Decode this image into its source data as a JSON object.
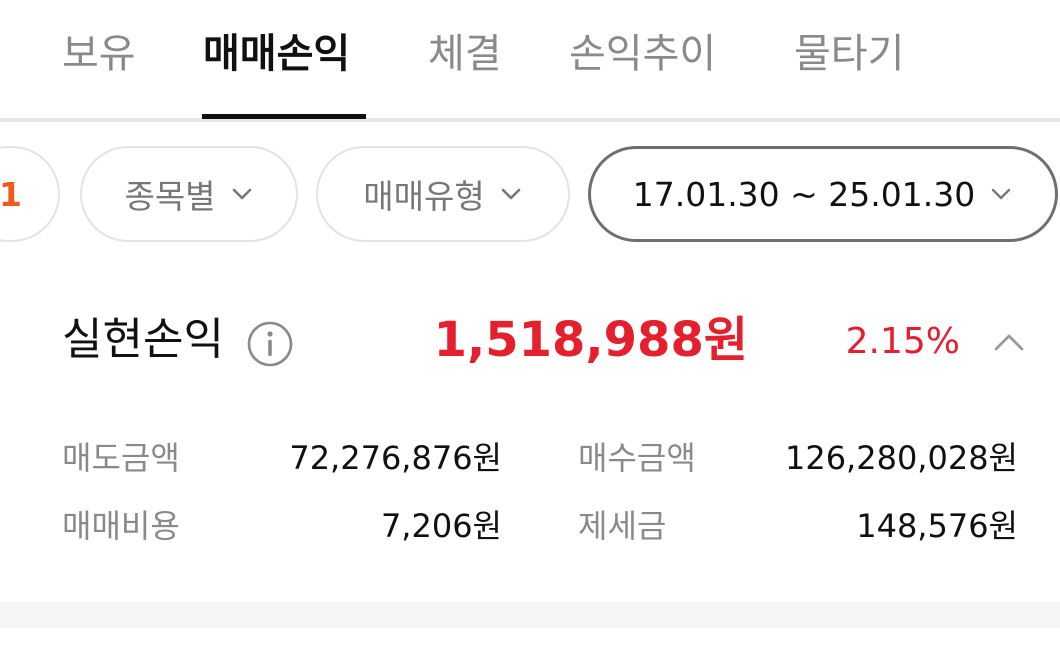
{
  "tabs": [
    {
      "label": "보유",
      "active": false
    },
    {
      "label": "매매손익",
      "active": true
    },
    {
      "label": "체결",
      "active": false
    },
    {
      "label": "손익추이",
      "active": false
    },
    {
      "label": "물타기",
      "active": false
    }
  ],
  "filters": {
    "partial_chip": "1",
    "by_item": "종목별",
    "trade_type": "매매유형",
    "date_range": "17.01.30 ~ 25.01.30"
  },
  "summary": {
    "label": "실현손익",
    "amount": "1,518,988원",
    "rate": "2.15%"
  },
  "details": {
    "sell_amount_label": "매도금액",
    "sell_amount_value": "72,276,876원",
    "buy_amount_label": "매수금액",
    "buy_amount_value": "126,280,028원",
    "trade_cost_label": "매매비용",
    "trade_cost_value": "7,206원",
    "tax_label": "제세금",
    "tax_value": "148,576원"
  },
  "icons": {
    "info": "info-icon",
    "collapse": "chevron-up-icon",
    "dropdown": "chevron-down-icon"
  },
  "colors": {
    "profit_red": "#e4202e",
    "accent_orange": "#f05a1a"
  }
}
